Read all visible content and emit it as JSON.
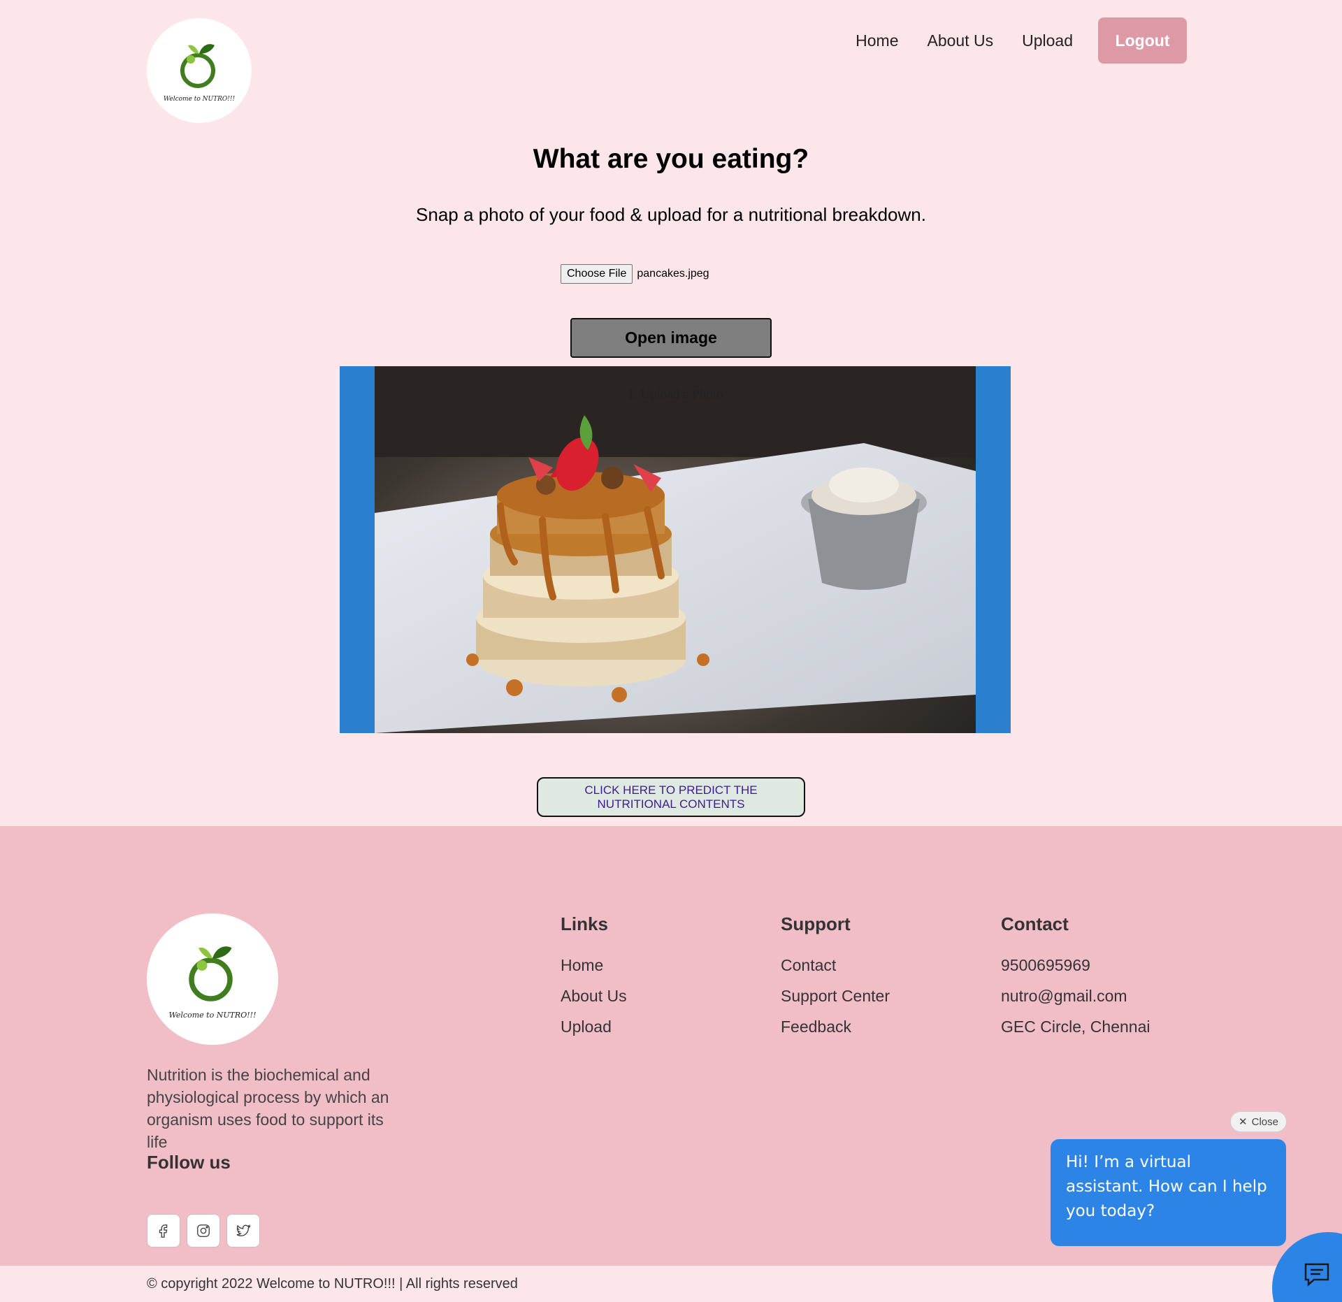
{
  "header": {
    "logo_text": "Welcome to NUTRO!!!",
    "nav": [
      "Home",
      "About Us",
      "Upload"
    ],
    "logout_label": "Logout"
  },
  "main": {
    "title": "What are you eating?",
    "subtitle": "Snap a photo of your food & upload for a nutritional breakdown.",
    "file_button": "Choose File",
    "file_name": "pancakes.jpeg",
    "open_button": "Open image",
    "photo_caption": "1. Upload a Photo",
    "predict_button": "CLICK HERE TO PREDICT THE NUTRITIONAL CONTENTS"
  },
  "footer": {
    "logo_text": "Welcome to NUTRO!!!",
    "description": "Nutrition is the biochemical and physiological process by which an organism uses food to support its life",
    "follow_title": "Follow us",
    "links": {
      "title": "Links",
      "items": [
        "Home",
        "About Us",
        "Upload"
      ]
    },
    "support": {
      "title": "Support",
      "items": [
        "Contact",
        "Support Center",
        "Feedback"
      ]
    },
    "contact": {
      "title": "Contact",
      "items": [
        "9500695969",
        "nutro@gmail.com",
        "GEC Circle, Chennai"
      ]
    },
    "copyright": "© copyright 2022 Welcome to NUTRO!!! | All rights reserved"
  },
  "chat": {
    "close_label": "Close",
    "message": "Hi! I’m a virtual assistant. How can I help you today?"
  },
  "colors": {
    "page_bg": "#fce6ea",
    "footer_bg": "#f1bec7",
    "logout_bg": "#dd9aa6",
    "image_frame": "#2b7fcf",
    "chat_blue": "#2d84e7"
  },
  "icons": [
    "logo-leaf-icon",
    "facebook-icon",
    "instagram-icon",
    "twitter-icon",
    "close-icon",
    "chat-icon"
  ]
}
